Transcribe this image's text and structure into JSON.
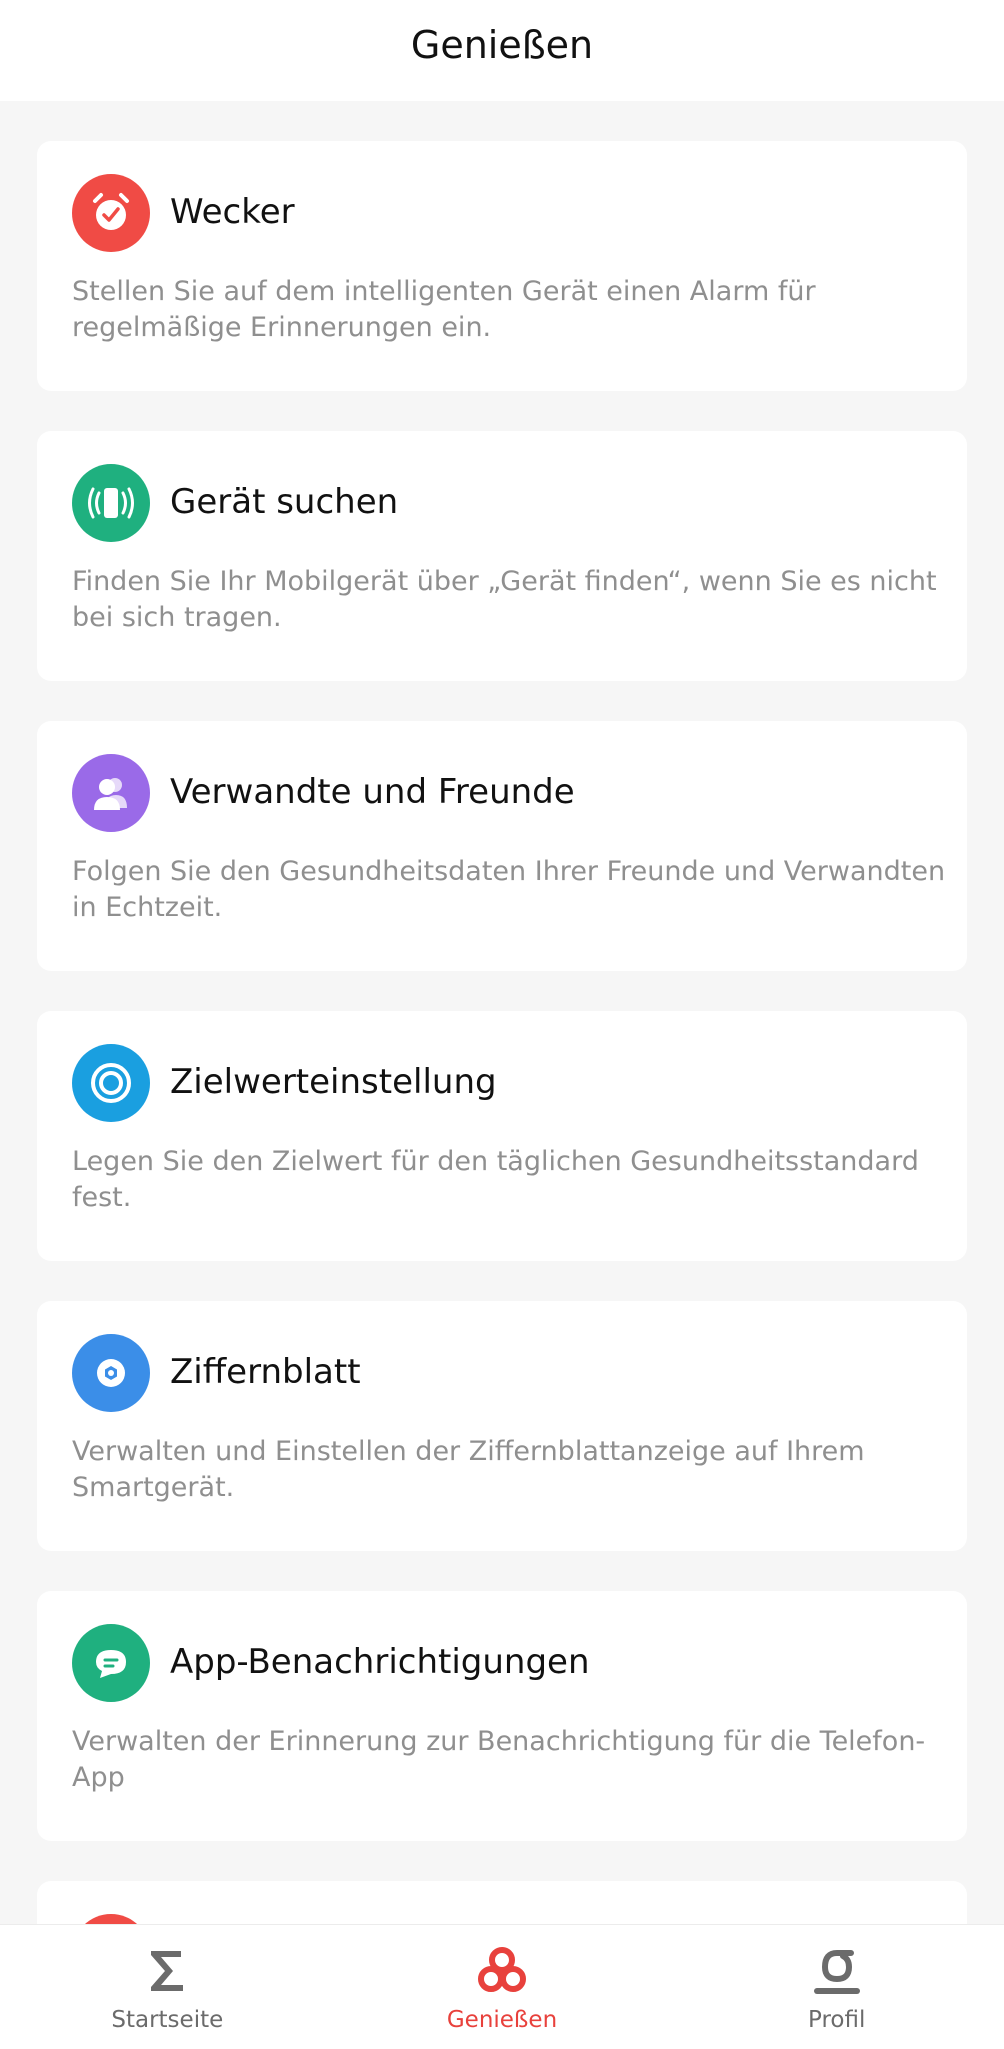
{
  "header": {
    "title": "Genießen"
  },
  "cards": [
    {
      "title": "Wecker",
      "description": "Stellen Sie auf dem intelligenten Gerät einen Alarm für regelmäßige Erinnerungen ein.",
      "icon": "alarm-clock-icon",
      "color": "#f04b45"
    },
    {
      "title": "Gerät suchen",
      "description": "Finden Sie Ihr Mobilgerät über „Gerät finden“, wenn Sie es nicht bei sich tragen.",
      "icon": "vibrating-phone-icon",
      "color": "#1fb07f"
    },
    {
      "title": "Verwandte und Freunde",
      "description": "Folgen Sie den Gesundheitsdaten Ihrer Freunde und Verwandten in Echtzeit.",
      "icon": "people-icon",
      "color": "#9a6ae8"
    },
    {
      "title": "Zielwerteinstellung",
      "description": "Legen Sie den Zielwert für den täglichen Gesundheitsstandard fest.",
      "icon": "target-icon",
      "color": "#1a9fe0"
    },
    {
      "title": "Ziffernblatt",
      "description": "Verwalten und Einstellen der Ziffernblattanzeige auf Ihrem Smartgerät.",
      "icon": "watch-face-icon",
      "color": "#3b8ee8"
    },
    {
      "title": "App-Benachrichtigungen",
      "description": "Verwalten der Erinnerung zur Benachrichtigung für die Telefon-App",
      "icon": "chat-bubble-icon",
      "color": "#1fb07f"
    }
  ],
  "partial_card": {
    "icon": "partial-icon",
    "color": "#f04b45"
  },
  "tabbar": {
    "tabs": [
      {
        "label": "Startseite",
        "icon": "sigma-icon",
        "active": false
      },
      {
        "label": "Genießen",
        "icon": "enjoy-icon",
        "active": true
      },
      {
        "label": "Profil",
        "icon": "profile-icon",
        "active": false
      }
    ],
    "active_color": "#e8413c",
    "inactive_color": "#6b6b6b"
  }
}
